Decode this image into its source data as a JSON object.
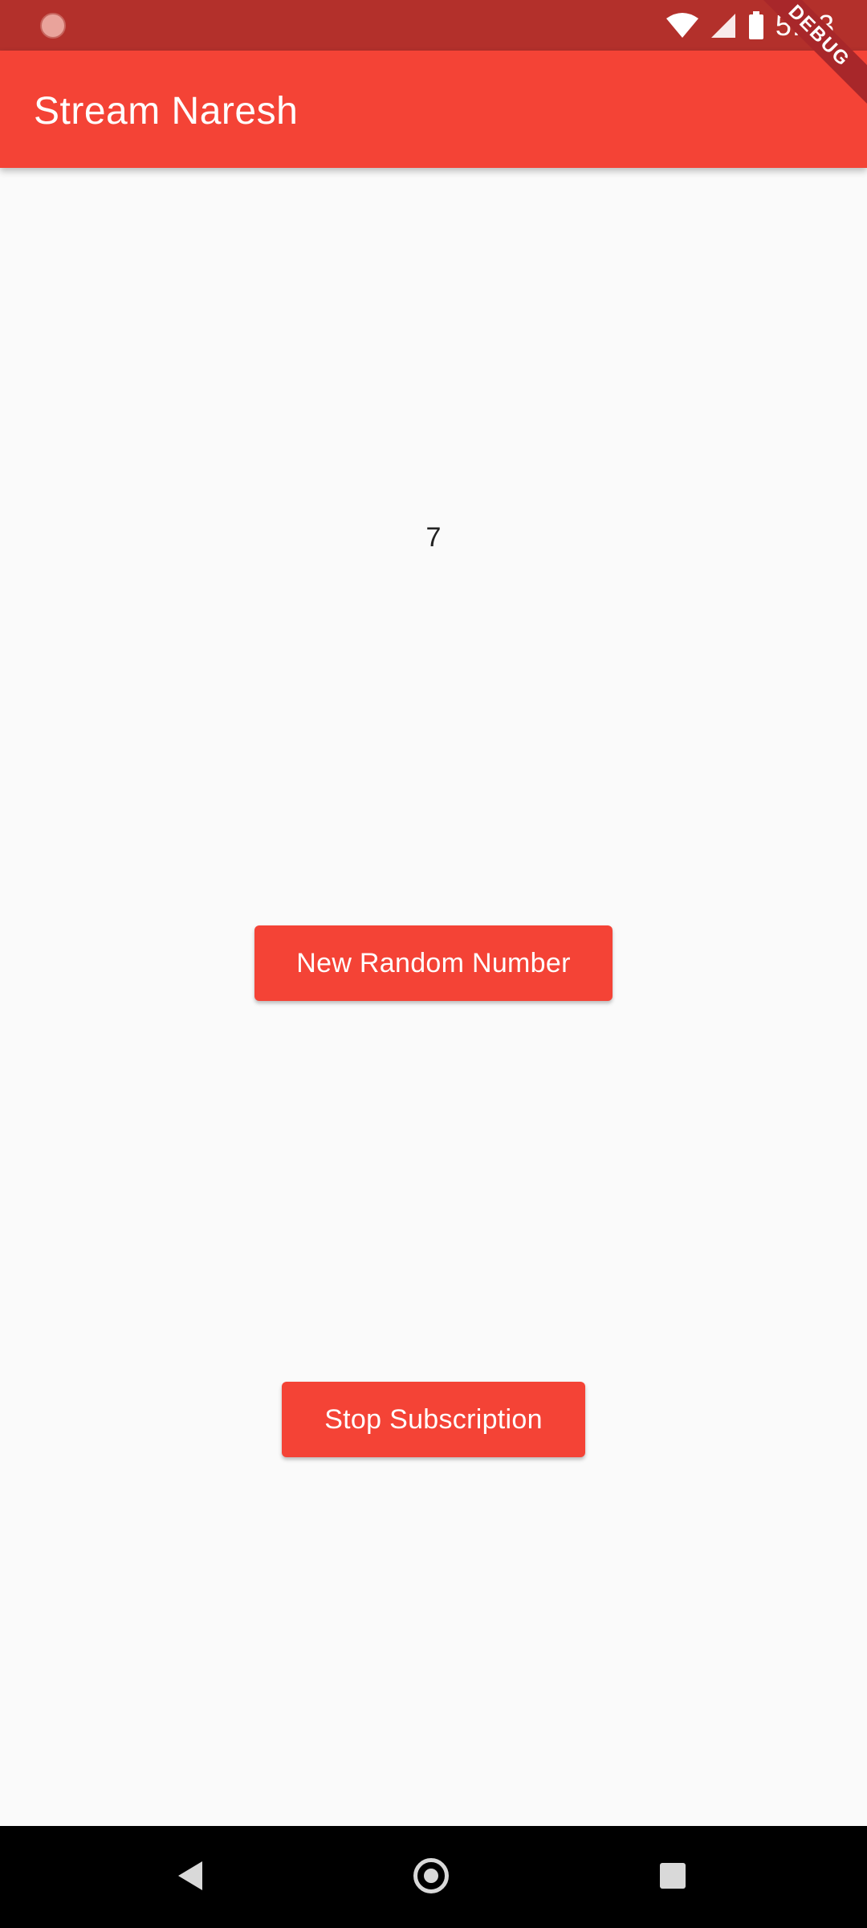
{
  "status_bar": {
    "time": "5:23"
  },
  "debug_banner": {
    "label": "DEBUG"
  },
  "app_bar": {
    "title": "Stream Naresh"
  },
  "content": {
    "random_number": "7",
    "new_random_button_label": "New Random Number",
    "stop_subscription_button_label": "Stop Subscription"
  },
  "colors": {
    "app_bar": "#f44336",
    "status_bar": "#b3302b",
    "button": "#f44336",
    "background": "#fafafa",
    "nav_bar": "#000000"
  },
  "icons": {
    "status_left": "notification-dot-icon",
    "wifi": "wifi-icon",
    "signal": "cell-signal-icon",
    "battery": "battery-icon",
    "nav_back": "back-icon",
    "nav_home": "home-icon",
    "nav_recent": "recent-apps-icon"
  }
}
